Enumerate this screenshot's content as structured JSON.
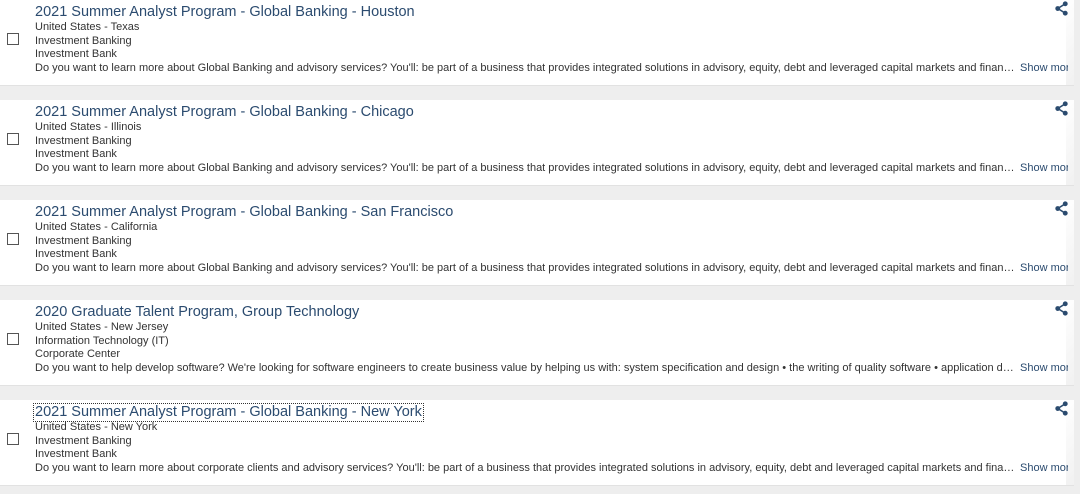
{
  "jobs": [
    {
      "title": "2021 Summer Analyst Program - Global Banking - Houston",
      "location": "United States - Texas",
      "function": "Investment Banking",
      "division": "Investment Bank",
      "description": "Do you want to learn more about Global Banking and advisory services? You'll: be part of a business that provides integrated solutions in advisory, equity, debt and leveraged capital markets and financing ...",
      "show_more": "Show more",
      "share_icon": "share-icon"
    },
    {
      "title": "2021 Summer Analyst Program - Global Banking - Chicago",
      "location": "United States - Illinois",
      "function": "Investment Banking",
      "division": "Investment Bank",
      "description": "Do you want to learn more about Global Banking and advisory services? You'll: be part of a business that provides integrated solutions in advisory, equity, debt and leveraged capital markets and financing ...",
      "show_more": "Show more",
      "share_icon": "share-icon"
    },
    {
      "title": "2021 Summer Analyst Program - Global Banking - San Francisco",
      "location": "United States - California",
      "function": "Investment Banking",
      "division": "Investment Bank",
      "description": "Do you want to learn more about Global Banking and advisory services? You'll: be part of a business that provides integrated solutions in advisory, equity, debt and leveraged capital markets and financing ...",
      "show_more": "Show more",
      "share_icon": "share-icon"
    },
    {
      "title": "2020 Graduate Talent Program, Group Technology",
      "location": "United States - New Jersey",
      "function": "Information Technology (IT)",
      "division": "Corporate Center",
      "description": "Do you want to help develop software? We're looking for software engineers to create business value by helping us with: system specification and design • the writing of quality software • application definit...",
      "show_more": "Show more",
      "share_icon": "share-icon"
    },
    {
      "title": "2021 Summer Analyst Program - Global Banking - New York",
      "location": "United States - New York",
      "function": "Investment Banking",
      "division": "Investment Bank",
      "description": "Do you want to learn more about corporate clients and advisory services? You'll: be part of a business that provides integrated solutions in advisory, equity, debt and leveraged capital markets and financin...",
      "show_more": "Show more",
      "share_icon": "share-icon"
    }
  ],
  "colors": {
    "page_background": "#eeeeee",
    "card_background": "#ffffff",
    "title": "#2b4b6f",
    "text": "#333333",
    "link": "#2b4b6f",
    "icon": "#2b4b6f"
  }
}
